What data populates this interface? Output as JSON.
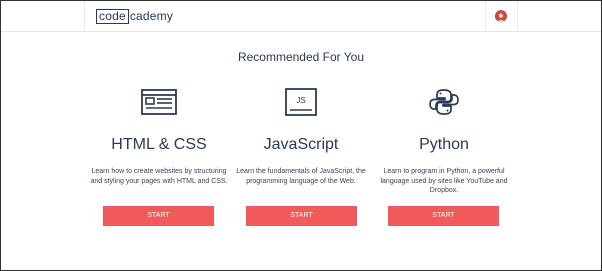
{
  "brand": {
    "logo_code": "code",
    "logo_cademy": "cademy"
  },
  "main": {
    "heading": "Recommended For You",
    "courses": [
      {
        "title": "HTML & CSS",
        "description": "Learn how to create websites by structuring and styling your pages with HTML and CSS.",
        "button_label": "START",
        "icon": "html-layout-icon"
      },
      {
        "title": "JavaScript",
        "description": "Learn the fundamentals of JavaScript, the programming language of the Web.",
        "button_label": "START",
        "icon": "js-icon",
        "icon_text": "JS"
      },
      {
        "title": "Python",
        "description": "Learn to program in Python, a powerful language used by sites like YouTube and Dropbox.",
        "button_label": "START",
        "icon": "python-icon"
      }
    ]
  },
  "colors": {
    "accent": "#f15a5a",
    "text_dark": "#2b3a55",
    "avatar": "#c94a46"
  }
}
